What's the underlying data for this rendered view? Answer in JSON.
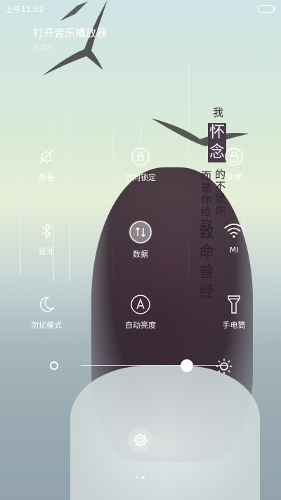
{
  "statusbar": {
    "time": "上午11:52"
  },
  "music": {
    "title": "打开音乐播放器",
    "subtitle": "无音乐"
  },
  "poem": {
    "col1": [
      "我",
      "怀",
      "念"
    ],
    "col2": [
      "的",
      "不",
      "是",
      "你"
    ],
    "col3": [
      "而",
      "是",
      "你",
      "给",
      "的"
    ],
    "col4": [
      "致",
      "命",
      "曾",
      "经"
    ]
  },
  "toggles": [
    {
      "label": "静音",
      "icon": "mute-bell-icon",
      "active": false
    },
    {
      "label": "方向锁定",
      "icon": "rotation-lock-icon",
      "active": false
    },
    {
      "label": "锁屏",
      "icon": "lock-screen-icon",
      "active": false
    },
    {
      "label": "蓝牙",
      "icon": "bluetooth-icon",
      "active": false
    },
    {
      "label": "数据",
      "icon": "mobile-data-icon",
      "active": true
    },
    {
      "label": "MI",
      "icon": "wifi-icon",
      "active": true
    },
    {
      "label": "勿扰模式",
      "icon": "moon-icon",
      "active": false
    },
    {
      "label": "自动亮度",
      "icon": "auto-brightness-icon",
      "active": false
    },
    {
      "label": "手电筒",
      "icon": "flashlight-icon",
      "active": false
    }
  ],
  "brightness": {
    "level": 0.72
  },
  "pager": {
    "pages": 2,
    "current": 2
  }
}
